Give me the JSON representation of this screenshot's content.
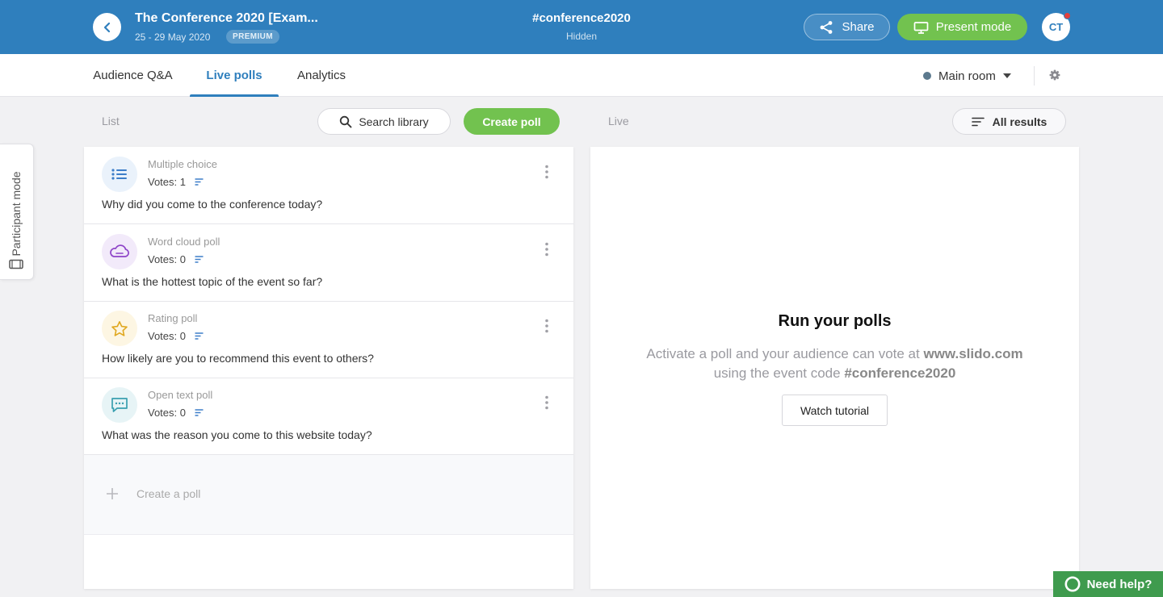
{
  "header": {
    "event_title": "The Conference 2020 [Exam...",
    "event_dates": "25 - 29 May 2020",
    "plan_badge": "PREMIUM",
    "event_code": "#conference2020",
    "event_visibility": "Hidden",
    "share_label": "Share",
    "present_label": "Present mode",
    "avatar_initials": "CT",
    "bar_color": "#2f7fbd",
    "accent_green": "#72c24f"
  },
  "tabs": [
    {
      "label": "Audience Q&A",
      "active": false
    },
    {
      "label": "Live polls",
      "active": true
    },
    {
      "label": "Analytics",
      "active": false
    }
  ],
  "room": {
    "label": "Main room"
  },
  "toolbar": {
    "list_label": "List",
    "search_library_label": "Search library",
    "create_poll_label": "Create poll",
    "live_label": "Live",
    "all_results_label": "All results"
  },
  "participant_mode": {
    "label": "Participant mode"
  },
  "polls": [
    {
      "type": "Multiple choice",
      "votes": "Votes: 1",
      "question": "Why did you come to the conference today?",
      "icon": "list-icon",
      "icon_color": "#3d7ec9",
      "icon_bg": "#eaf2fb"
    },
    {
      "type": "Word cloud poll",
      "votes": "Votes: 0",
      "question": "What is the hottest topic of the event so far?",
      "icon": "cloud-icon",
      "icon_color": "#8e44c8",
      "icon_bg": "#f2eafa"
    },
    {
      "type": "Rating poll",
      "votes": "Votes: 0",
      "question": "How likely are you to recommend this event to others?",
      "icon": "star-icon",
      "icon_color": "#e0a820",
      "icon_bg": "#fdf6e3"
    },
    {
      "type": "Open text poll",
      "votes": "Votes: 0",
      "question": "What was the reason you come to this website today?",
      "icon": "chat-icon",
      "icon_color": "#3aa0b0",
      "icon_bg": "#e7f4f6"
    }
  ],
  "create_row": {
    "label": "Create a poll"
  },
  "live_panel": {
    "title": "Run your polls",
    "desc_prefix": "Activate a poll and your audience can vote at ",
    "desc_site": "www.slido.com",
    "desc_middle": "using the event code ",
    "desc_code": "#conference2020",
    "watch_label": "Watch tutorial"
  },
  "help": {
    "label": "Need help?"
  }
}
